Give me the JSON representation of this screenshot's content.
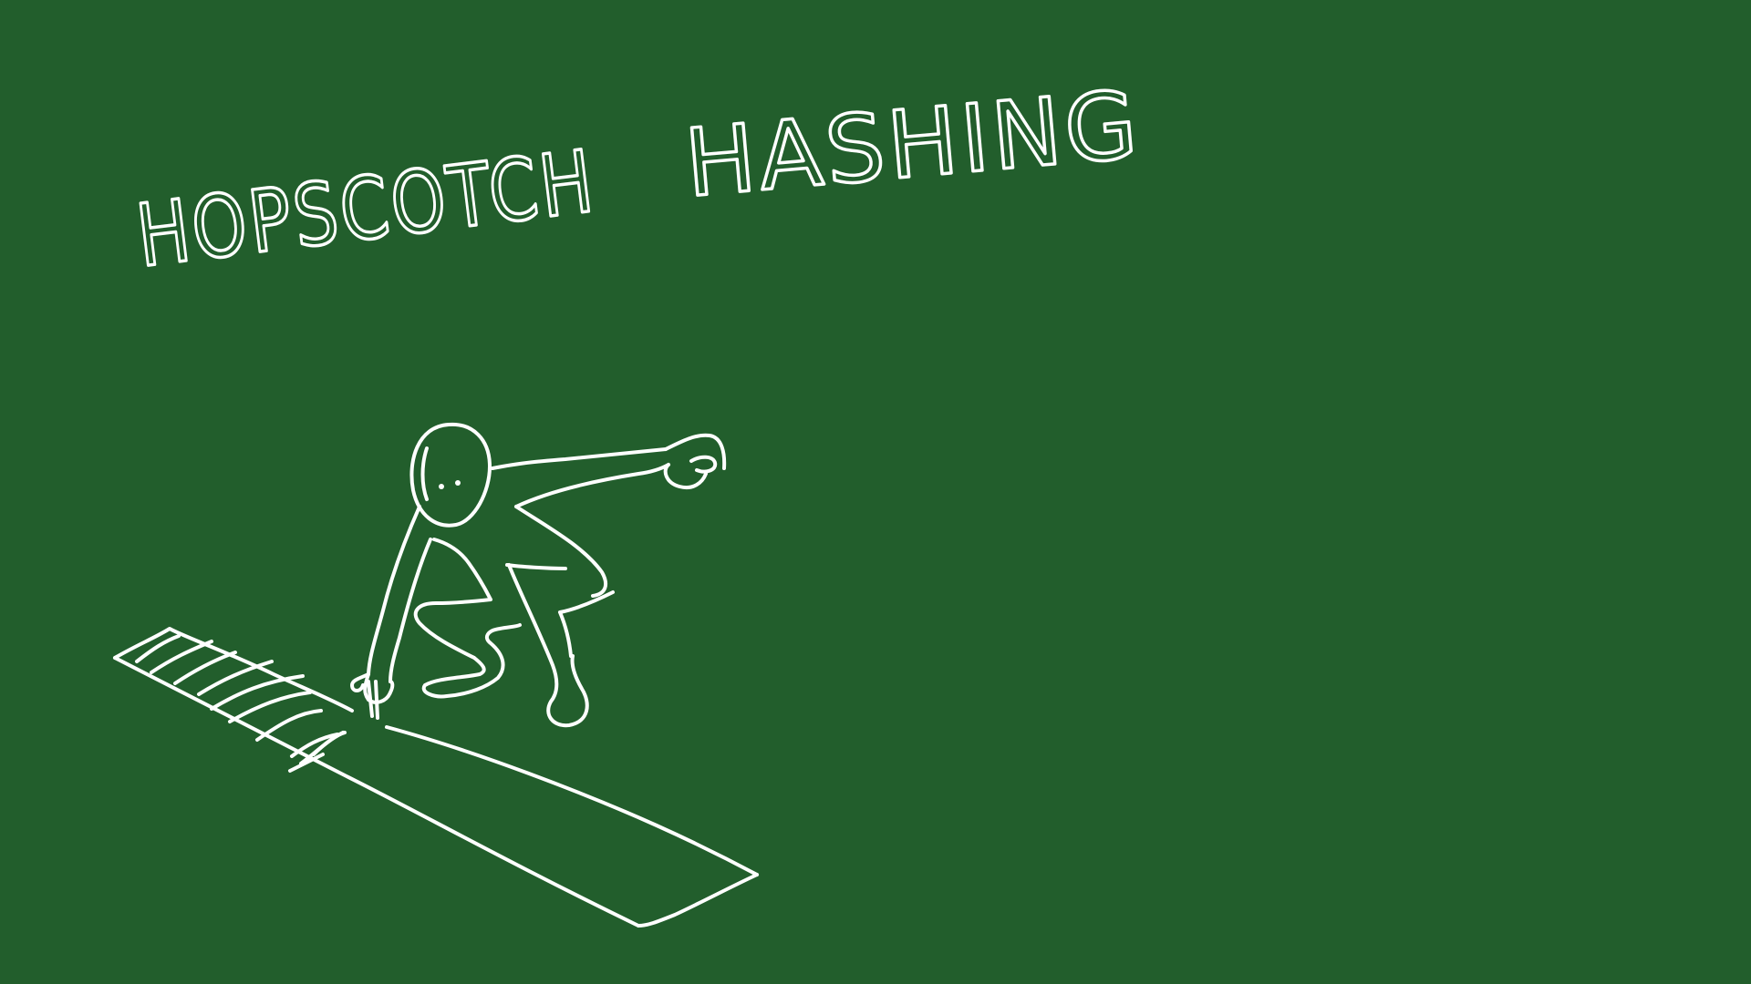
{
  "board": {
    "background_color": "#225e2c",
    "chalk_color": "#ffffff"
  },
  "title": {
    "word1": "HOPSCOTCH",
    "word2": "HASHING"
  }
}
